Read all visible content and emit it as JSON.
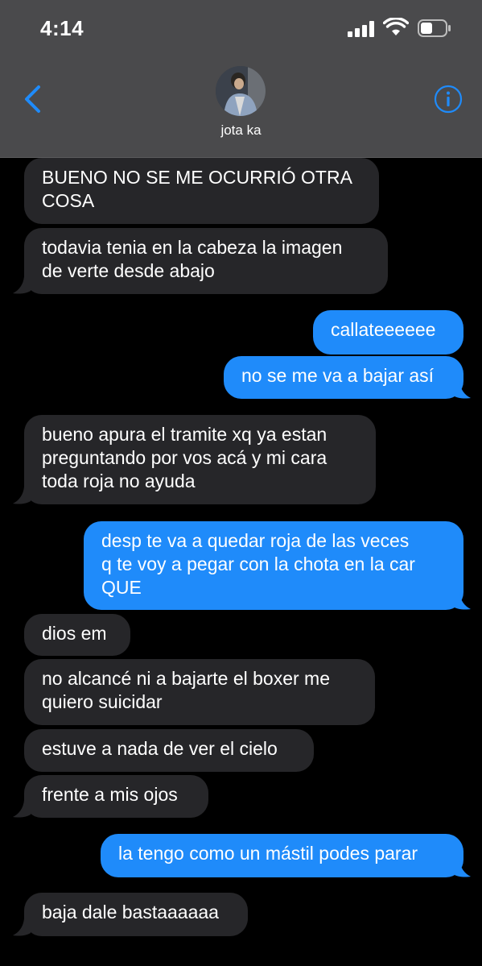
{
  "status_bar": {
    "time": "4:14"
  },
  "header": {
    "contact_name": "jota ka"
  },
  "colors": {
    "incoming": "#262629",
    "outgoing": "#1f8bfa",
    "header": "#4a4a4c",
    "accent": "#1f8bfa"
  },
  "icons": [
    "chevron-left-icon",
    "info-icon",
    "signal-icon",
    "wifi-icon",
    "battery-icon"
  ],
  "messages": [
    {
      "dir": "in",
      "text": "BUENO NO SE ME OCURRIÓ OTRA\nCOSA"
    },
    {
      "dir": "in",
      "text": "todavia tenia en la cabeza la imagen\nde verte desde abajo"
    },
    {
      "dir": "out",
      "text": "callateeeeee"
    },
    {
      "dir": "out",
      "text": "no se me va a bajar así"
    },
    {
      "dir": "in",
      "text": "bueno apura el tramite xq ya estan\npreguntando por vos acá y mi cara\ntoda roja no ayuda"
    },
    {
      "dir": "out",
      "text": "desp te va a quedar roja de las veces\nq te voy a pegar con la chota en la car\nQUE"
    },
    {
      "dir": "in",
      "text": "dios em"
    },
    {
      "dir": "in",
      "text": "no alcancé ni a bajarte el boxer me\nquiero suicidar"
    },
    {
      "dir": "in",
      "text": "estuve a nada de ver el cielo"
    },
    {
      "dir": "in",
      "text": "frente a mis ojos"
    },
    {
      "dir": "out",
      "text": "la tengo como un mástil podes parar"
    },
    {
      "dir": "in",
      "text": "baja dale bastaaaaaa"
    }
  ]
}
